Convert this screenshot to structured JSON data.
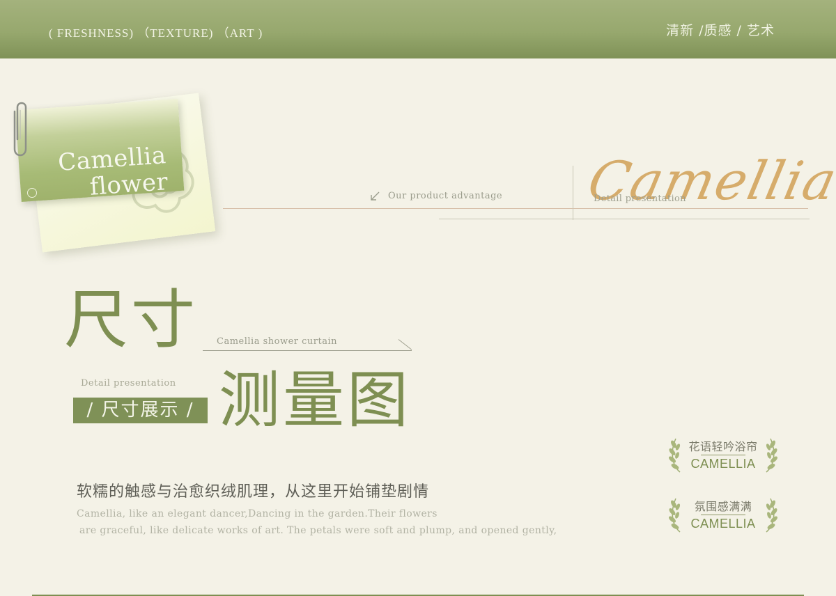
{
  "header": {
    "left_tags": "( FRESHNESS) （TEXTURE) （ART )",
    "right_tags": "清新 /质感 / 艺术"
  },
  "card": {
    "title_line1": "Camellia",
    "title_line2": "flower"
  },
  "advantage": {
    "label": "Our product advantage",
    "detail_label": "Detail presentation",
    "script_word": "Camellia"
  },
  "headline": {
    "part1": "尺寸",
    "subtitle_en": "Camellia shower curtain",
    "detail_label": "Detail presentation",
    "tag": "/ 尺寸展示 /",
    "part2": "测量图"
  },
  "description": {
    "cn": "软糯的触感与治愈织绒肌理，从这里开始铺垫剧情",
    "en_line1": "Camellia, like an elegant dancer,Dancing in the garden.Their flowers",
    "en_line2": "are graceful, like delicate works of art. The petals were soft and plump, and opened gently,"
  },
  "badges": [
    {
      "cn": "花语轻吟浴帘",
      "en": "CAMELLIA"
    },
    {
      "cn": "氛围感满满",
      "en": "CAMELLIA"
    }
  ],
  "colors": {
    "header_green": "#97a86e",
    "accent_green": "#7e8f52",
    "background": "#f4f2e7",
    "script_gold": "#d3a55e"
  }
}
